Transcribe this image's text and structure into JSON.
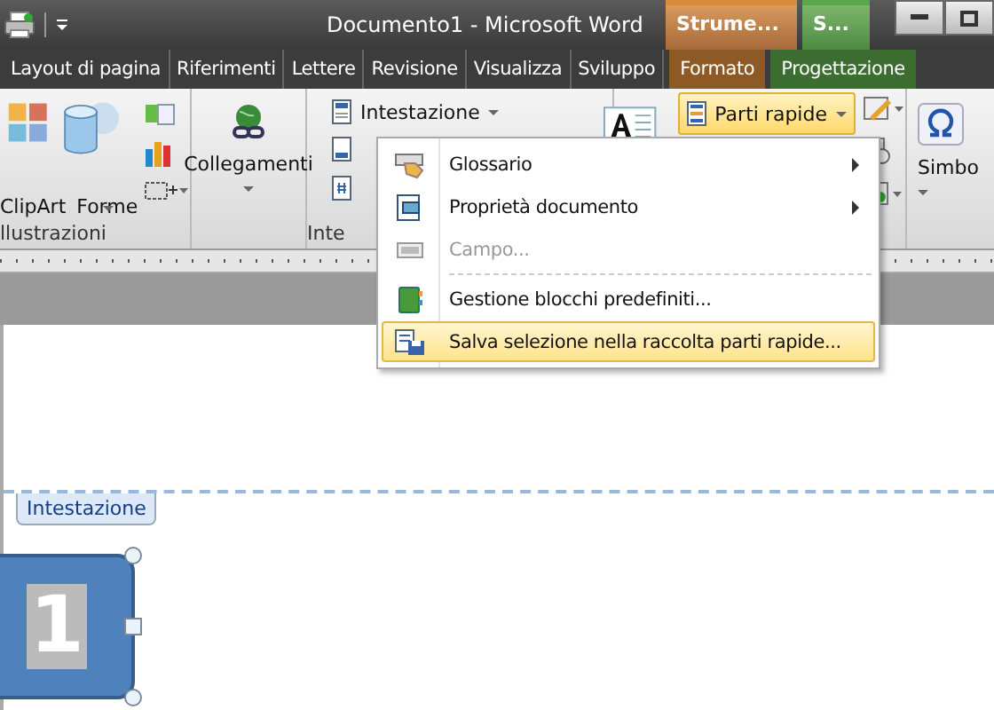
{
  "window": {
    "title": "Documento1  -  Microsoft Word"
  },
  "context_tools": [
    {
      "label": "Strume...",
      "color": "#d98b3a"
    },
    {
      "label": "S...",
      "color": "#5aa84a"
    }
  ],
  "tabs": [
    {
      "label": "Layout di pagina",
      "selected": false,
      "kind": "normal"
    },
    {
      "label": "Riferimenti",
      "selected": false,
      "kind": "normal"
    },
    {
      "label": "Lettere",
      "selected": false,
      "kind": "normal"
    },
    {
      "label": "Revisione",
      "selected": false,
      "kind": "normal"
    },
    {
      "label": "Visualizza",
      "selected": false,
      "kind": "normal"
    },
    {
      "label": "Sviluppo",
      "selected": false,
      "kind": "normal"
    },
    {
      "label": "Formato",
      "selected": false,
      "kind": "contextual"
    },
    {
      "label": "Progettazione",
      "selected": false,
      "kind": "contextual"
    }
  ],
  "ribbon": {
    "illustrazioni": {
      "buttons": [
        "ClipArt",
        "Forme"
      ],
      "label": "llustrazioni"
    },
    "collegamenti": {
      "button": "Collegamenti"
    },
    "intestazione": {
      "button": "Intestazione",
      "label": "Inte"
    },
    "parti_rapide": {
      "button": "Parti rapide",
      "highlighted": true
    },
    "simboli": {
      "button": "Simbo"
    }
  },
  "menu": {
    "items": [
      {
        "label": "Glossario",
        "kind": "item",
        "disabled": false,
        "selected": false,
        "submenu": true
      },
      {
        "label": "Proprietà documento",
        "kind": "item",
        "disabled": false,
        "selected": false,
        "submenu": true
      },
      {
        "label": "Campo...",
        "kind": "item",
        "disabled": true,
        "selected": false,
        "submenu": false
      },
      {
        "kind": "separator"
      },
      {
        "label": "Gestione blocchi predefiniti...",
        "kind": "item",
        "disabled": false,
        "selected": false,
        "submenu": false
      },
      {
        "label": "Salva selezione nella raccolta parti rapide...",
        "kind": "item",
        "disabled": false,
        "selected": true,
        "submenu": false
      }
    ]
  },
  "document": {
    "header_tag": "Intestazione",
    "page_number": "1"
  }
}
